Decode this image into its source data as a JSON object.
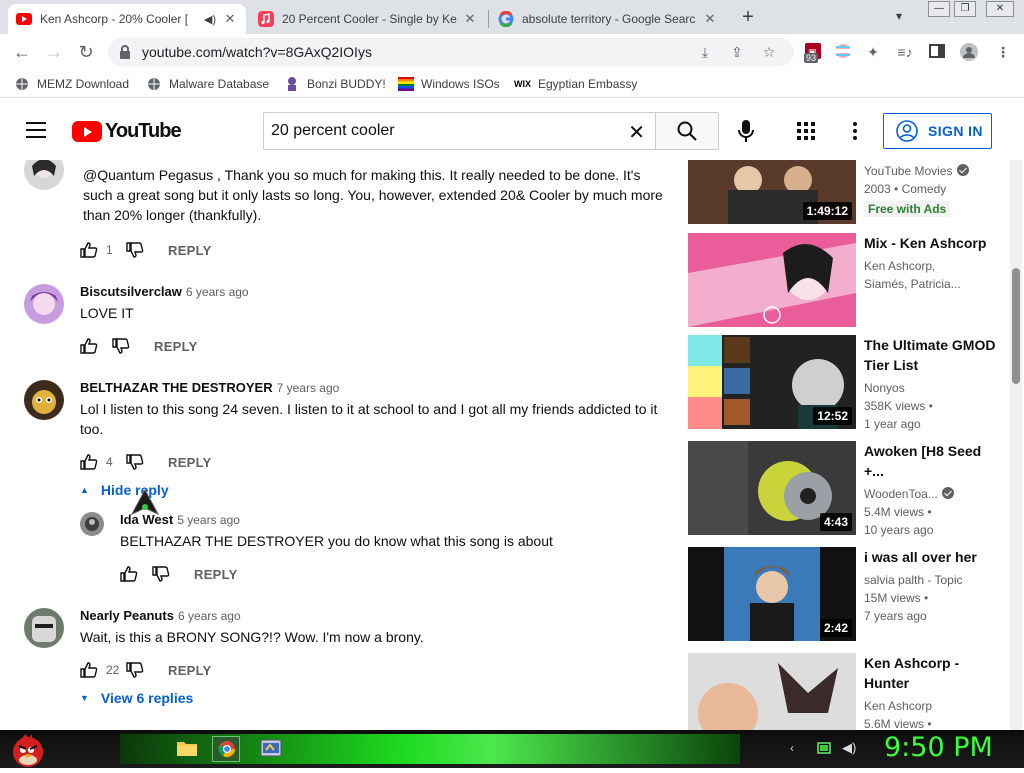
{
  "browser": {
    "tabs": [
      {
        "title": "Ken Ashcorp - 20% Cooler [",
        "active": true
      },
      {
        "title": "20 Percent Cooler - Single by Ke",
        "active": false
      },
      {
        "title": "absolute territory - Google Searc",
        "active": false
      }
    ],
    "url": "youtube.com/watch?v=8GAxQ2IOIys",
    "extension_badge": "93",
    "bookmarks": [
      "MEMZ Download",
      "Malware Database",
      "Bonzi BUDDY!",
      "Windows ISOs",
      "Egyptian Embassy"
    ],
    "bookmark_wix_label": "WIX"
  },
  "youtube": {
    "logo_text": "YouTube",
    "search_query": "20 percent cooler",
    "signin_label": "SIGN IN"
  },
  "comments": [
    {
      "author": "",
      "time": "",
      "text": "@Quantum Pegasus , Thank you so much for making this. It really needed to be done. It's such a great song but it only lasts so long. You, however, extended 20& Cooler by much more than 20% longer (thankfully).",
      "likes": "1",
      "reply": "REPLY"
    },
    {
      "author": "Biscutsilverclaw",
      "time": "6 years ago",
      "text": "LOVE IT",
      "likes": "",
      "reply": "REPLY"
    },
    {
      "author": "BELTHAZAR THE DESTROYER",
      "time": "7 years ago",
      "text": "Lol I listen to this song 24 seven. I listen to it at school to and I got all my friends addicted to it too.",
      "likes": "4",
      "reply": "REPLY"
    },
    {
      "author": "Ida West",
      "time": "5 years ago",
      "text": "BELTHAZAR THE DESTROYER you do know what this song is about",
      "likes": "",
      "reply": "REPLY"
    },
    {
      "author": "Nearly Peanuts",
      "time": "6 years ago",
      "text": "Wait, is this a BRONY SONG?!? Wow. I'm now a brony.",
      "likes": "22",
      "reply": "REPLY"
    }
  ],
  "thread_toggles": {
    "hide": "Hide reply",
    "view": "View 6 replies"
  },
  "related": [
    {
      "title": "",
      "channel": "YouTube Movies",
      "line2": "2003 • Comedy",
      "badge": "Free with Ads",
      "duration": "1:49:12"
    },
    {
      "title": "Mix - Ken Ashcorp",
      "channel": "Ken Ashcorp,",
      "line2": "Siamés, Patricia...",
      "badge": "",
      "duration": ""
    },
    {
      "title": "The Ultimate GMOD Tier List",
      "channel": "Nonyos",
      "line2": "358K views •",
      "line3": "1 year ago",
      "duration": "12:52"
    },
    {
      "title": "Awoken [H8 Seed +...",
      "channel": "WoodenToa...",
      "line2": "5.4M views •",
      "line3": "10 years ago",
      "duration": "4:43"
    },
    {
      "title": "i was all over her",
      "channel": "salvia palth - Topic",
      "line2": "15M views •",
      "line3": "7 years ago",
      "duration": "2:42"
    },
    {
      "title": "Ken Ashcorp - Hunter",
      "channel": "Ken Ashcorp",
      "line2": "5.6M views •",
      "line3": "",
      "duration": ""
    }
  ],
  "taskbar": {
    "clock": "9:50 PM"
  },
  "colors": {
    "link_blue": "#065fd4",
    "youtube_red": "#ff0000",
    "clock_green": "#39ff39"
  }
}
